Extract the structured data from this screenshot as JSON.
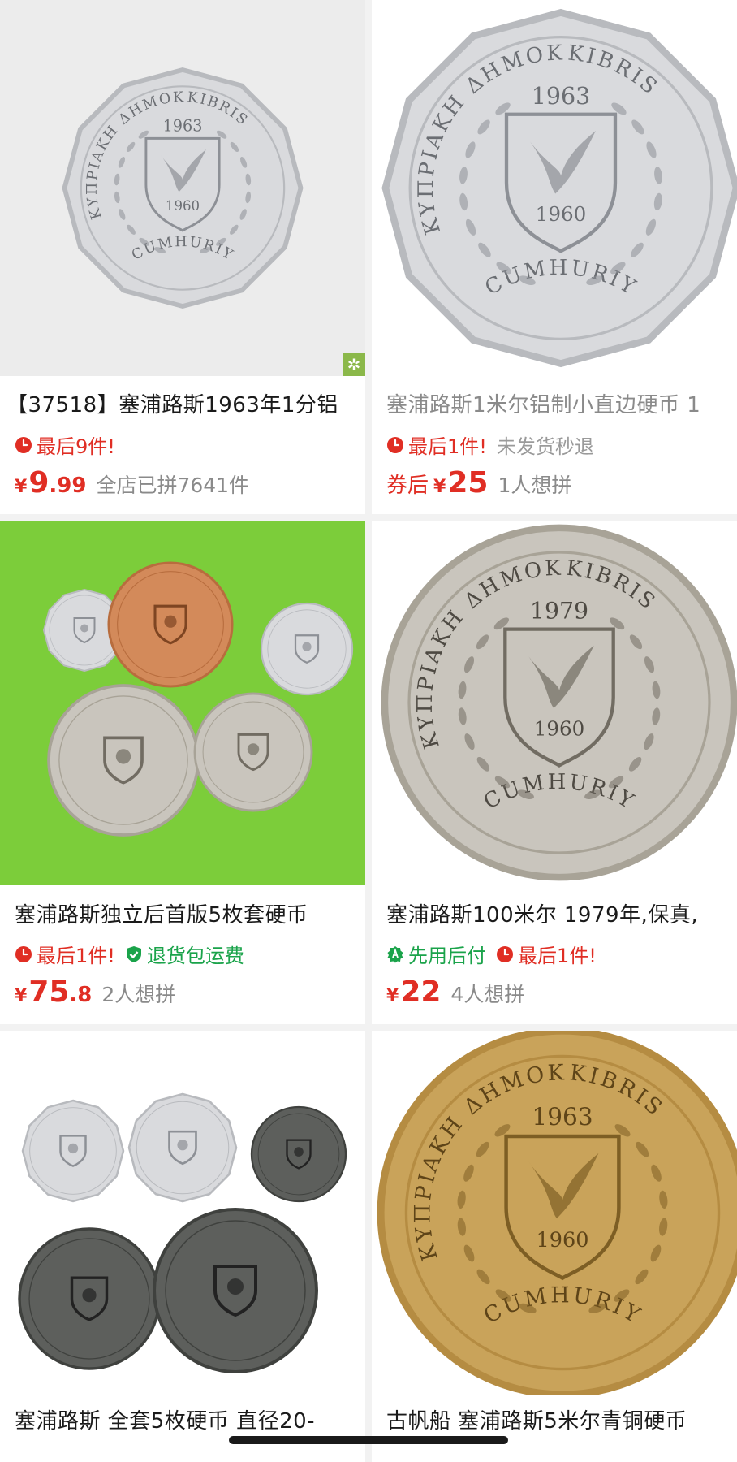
{
  "products": [
    {
      "title": "【37518】塞浦路斯1963年1分铝",
      "tags": [
        {
          "icon": "clock-icon",
          "text": "最后9件!",
          "color": "red"
        }
      ],
      "price": {
        "prefix": "",
        "yen": "¥",
        "int": "9",
        "dec": ".99"
      },
      "sub": "全店已拼7641件",
      "image": {
        "type": "single-coin",
        "metal": "aluminium",
        "year": "1963",
        "legend_left": "ΚΥΠΡΙΑΚΗ ΔΗΜΟΚΡΑΤΙΑ",
        "legend_right": "KIBRIS CUMHURIYETI",
        "shield_year": "1960"
      }
    },
    {
      "title": "塞浦路斯1米尔铝制小直边硬币 1",
      "tags": [
        {
          "icon": "clock-icon",
          "text": "最后1件!",
          "color": "red"
        },
        {
          "icon": "",
          "text": "未发货秒退",
          "color": "gray"
        }
      ],
      "price": {
        "prefix": "券后",
        "yen": "¥",
        "int": "25",
        "dec": ""
      },
      "sub": "1人想拼",
      "image": {
        "type": "single-coin",
        "metal": "aluminium",
        "year": "1963",
        "legend_left": "ΚΥΠΡΙΑΚΗ ΔΗΜΟΚΡΑΤΙΑ",
        "legend_right": "KIBRIS CUMHURIYETI",
        "shield_year": "1960"
      }
    },
    {
      "title": "塞浦路斯独立后首版5枚套硬币",
      "tags": [
        {
          "icon": "clock-icon",
          "text": "最后1件!",
          "color": "red"
        },
        {
          "icon": "shield-check-icon",
          "text": "退货包运费",
          "color": "green"
        }
      ],
      "price": {
        "prefix": "",
        "yen": "¥",
        "int": "75",
        "dec": ".8"
      },
      "sub": "2人想拼",
      "image": {
        "type": "coin-set-green"
      }
    },
    {
      "title": "塞浦路斯100米尔 1979年,保真,",
      "tags": [
        {
          "icon": "pay-later-icon",
          "text": "先用后付",
          "color": "green"
        },
        {
          "icon": "clock-icon",
          "text": "最后1件!",
          "color": "red"
        }
      ],
      "price": {
        "prefix": "",
        "yen": "¥",
        "int": "22",
        "dec": ""
      },
      "sub": "4人想拼",
      "image": {
        "type": "single-coin",
        "metal": "nickel",
        "year": "1979",
        "legend_left": "ΚΥΠΡΙΑΚΗ ΔΗΜΟΚΡΑΤΙΑ",
        "legend_right": "KIBRIS CUMHURIYETI",
        "shield_year": "1960"
      }
    },
    {
      "title": "塞浦路斯 全套5枚硬币 直径20-",
      "tags": [],
      "price": null,
      "sub": "",
      "image": {
        "type": "coin-set-white"
      }
    },
    {
      "title": "古帆船 塞浦路斯5米尔青铜硬币",
      "tags": [],
      "price": null,
      "sub": "",
      "image": {
        "type": "single-coin",
        "metal": "bronze",
        "year": "1963",
        "legend_left": "ΚΥΠΡΙΑΚΗ ΔΗΜΟΚΡΑΤΙΑ",
        "legend_right": "KIBRIS CUMHURIYETI",
        "shield_year": "1960"
      }
    }
  ],
  "corner_badge": "✲",
  "colors": {
    "accent_red": "#e02e24",
    "accent_green": "#1aa34a",
    "muted": "#8a8a8a",
    "background": "#f2f2f2"
  }
}
